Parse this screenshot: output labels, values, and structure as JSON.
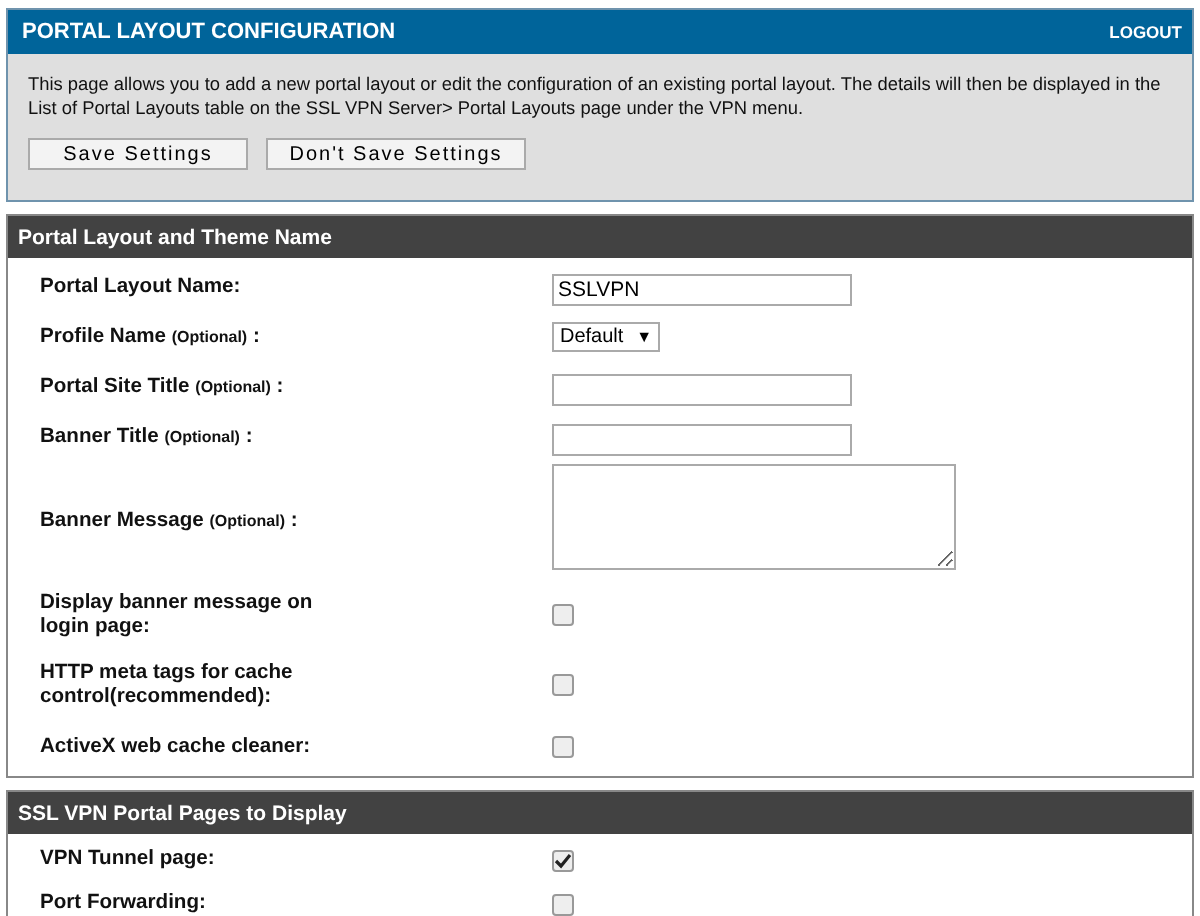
{
  "header": {
    "title": "PORTAL LAYOUT CONFIGURATION",
    "logout": "LOGOUT"
  },
  "intro": "This page allows you to add a new portal layout or edit the configuration of an existing portal layout. The details will then be displayed in the List of Portal Layouts table on the SSL VPN Server> Portal Layouts page under the VPN menu.",
  "buttons": [
    "Save Settings",
    "Don't Save Settings"
  ],
  "sections": [
    {
      "title": "Portal Layout and Theme Name",
      "rows": [
        {
          "kind": "text",
          "label": "Portal Layout Name:",
          "value": "SSLVPN"
        },
        {
          "kind": "select",
          "label": "Profile Name",
          "note": "(Optional)",
          "tail": ":",
          "value": "Default",
          "arrow": "▼"
        },
        {
          "kind": "text",
          "label": "Portal Site Title",
          "note": "(Optional)",
          "tail": ":"
        },
        {
          "kind": "text",
          "label": "Banner Title",
          "note": "(Optional)",
          "tail": ":"
        },
        {
          "kind": "textarea",
          "label": "Banner Message",
          "note": "(Optional)",
          "tail": ":"
        },
        {
          "kind": "checkbox",
          "label": "Display banner message on login page:",
          "checked": false
        },
        {
          "kind": "checkbox",
          "label": "HTTP meta tags for cache control(recommended):",
          "checked": false
        },
        {
          "kind": "checkbox",
          "label": "ActiveX web cache cleaner:",
          "checked": false
        }
      ]
    },
    {
      "title": "SSL VPN Portal Pages to Display",
      "rows": [
        {
          "kind": "checkbox",
          "label": "VPN Tunnel page:",
          "checked": true
        },
        {
          "kind": "checkbox",
          "label": "Port Forwarding:",
          "checked": false
        }
      ]
    }
  ]
}
